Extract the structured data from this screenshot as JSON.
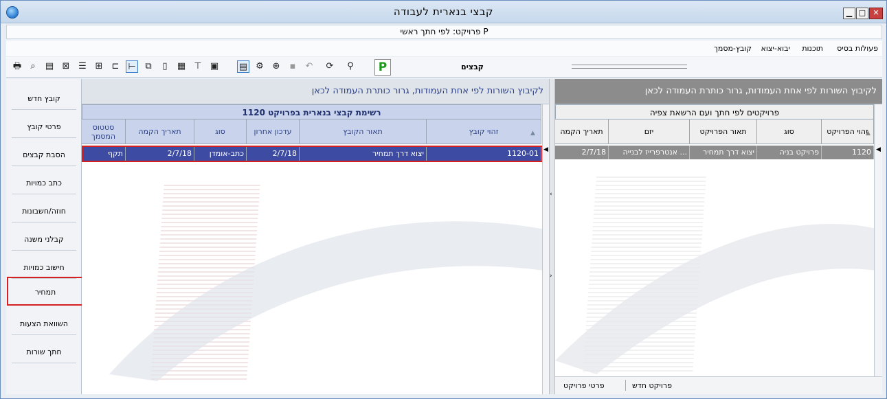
{
  "window": {
    "title": "קבצי בנארית לעבודה",
    "subtitle": "פרויקט: לפי חתך ראשי P"
  },
  "menu": [
    "פעולות בסיס",
    "תוכנות",
    "יבוא-יצוא",
    "קובץ-מסמך"
  ],
  "toolbar": {
    "label": "קבצים",
    "p_button": "P"
  },
  "sidebar": [
    "קובץ חדש",
    "פרטי קובץ",
    "הסבת קבצים",
    "כתב כמויות",
    "חוזה/חשבונות",
    "קבלני משנה",
    "חישוב כמויות",
    "תמחיר",
    "השוואת הצעות",
    "חתך שורות"
  ],
  "center": {
    "group_hint": "לקיבוץ השורות לפי אחת העמודות, גרור כותרת העמודה לכאן",
    "grid_title": "רשימת קבצי בנארית בפרויקט 1120",
    "columns": [
      "זהוי קובץ",
      "תאור הקובץ",
      "עדכון אחרון",
      "סוג",
      "תאריך הקמה",
      "סטטוס המסמך"
    ],
    "rows": [
      [
        "1120-01",
        "יצוא דרך תמחיר",
        "2/7/18",
        "כתב-אומדן",
        "2/7/18",
        "תקף"
      ]
    ]
  },
  "right": {
    "group_hint": "לקיבוץ השורות לפי אחת העמודות, גרור כותרת העמודה לכאן",
    "grid_title": "פרויקטים לפי חתך ועם הרשאת צפיה",
    "columns": [
      "זהוי הפרויקט",
      "סוג",
      "תאור הפרויקט",
      "יזם",
      "תאריך הקמה"
    ],
    "rows": [
      [
        "1120",
        "פרויקט בניה",
        "יצוא דרך תמחיר",
        "אנטרפרייז לבנייה ...",
        "2/7/18"
      ]
    ],
    "bottom_links": [
      "פרויקט חדש",
      "פרטי פרויקט"
    ]
  },
  "colors": {
    "selection": "#3d4ba3",
    "gray_header": "#8c8c8c",
    "highlight_red": "#d62020",
    "accent_blue": "#2b3f87"
  }
}
